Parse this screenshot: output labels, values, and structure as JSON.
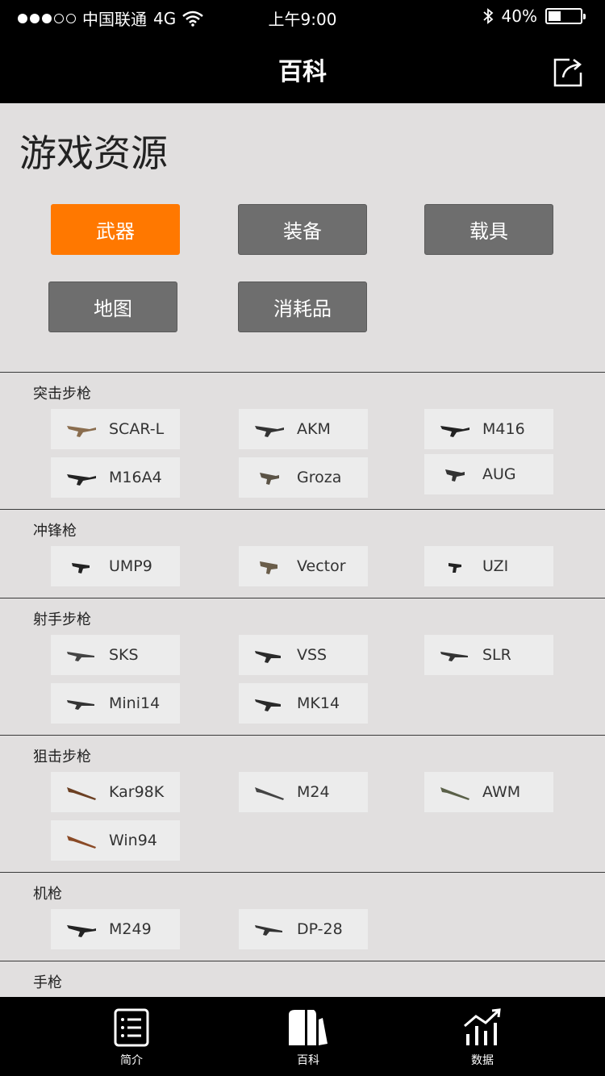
{
  "status_bar": {
    "carrier": "中国联通",
    "network": "4G",
    "time": "上午9:00",
    "battery": "40%",
    "battery_level": 0.4
  },
  "nav": {
    "title": "百科"
  },
  "page": {
    "title": "游戏资源",
    "categories": [
      {
        "label": "武器",
        "active": true
      },
      {
        "label": "装备",
        "active": false
      },
      {
        "label": "载具",
        "active": false
      },
      {
        "label": "地图",
        "active": false
      },
      {
        "label": "消耗品",
        "active": false
      }
    ]
  },
  "sections": [
    {
      "title": "突击步枪",
      "items": [
        "SCAR-L",
        "AKM",
        "M416",
        "M16A4",
        "Groza",
        "AUG"
      ]
    },
    {
      "title": "冲锋枪",
      "items": [
        "UMP9",
        "Vector",
        "UZI"
      ]
    },
    {
      "title": "射手步枪",
      "items": [
        "SKS",
        "VSS",
        "SLR",
        "Mini14",
        "MK14"
      ]
    },
    {
      "title": "狙击步枪",
      "items": [
        "Kar98K",
        "M24",
        "AWM",
        "Win94"
      ]
    },
    {
      "title": "机枪",
      "items": [
        "M249",
        "DP-28"
      ]
    },
    {
      "title": "手枪",
      "items": []
    }
  ],
  "tab_bar": {
    "tabs": [
      {
        "label": "简介",
        "icon": "list-icon"
      },
      {
        "label": "百科",
        "icon": "books-icon"
      },
      {
        "label": "数据",
        "icon": "chart-icon"
      }
    ]
  },
  "colors": {
    "accent": "#ff7800",
    "button_gray": "#6e6e6e",
    "background": "#e1dfdf",
    "card": "#ececec"
  }
}
